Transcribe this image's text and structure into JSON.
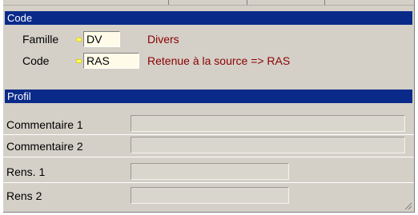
{
  "code_section": {
    "title": "Code",
    "famille": {
      "label": "Famille",
      "code": "DV",
      "description": "Divers"
    },
    "code": {
      "label": "Code",
      "code": "RAS",
      "description": "Retenue à la source => RAS"
    }
  },
  "profil_section": {
    "title": "Profil",
    "fields": [
      {
        "label": "Commentaire 1",
        "value": ""
      },
      {
        "label": "Commentaire 2",
        "value": ""
      },
      {
        "label": "Rens. 1",
        "value": ""
      },
      {
        "label": "Rens 2",
        "value": ""
      }
    ]
  },
  "colors": {
    "header_bg": "#0a2a8a",
    "description_text": "#8b0000",
    "required_marker": "#ffff66"
  },
  "icons": {
    "resize_grip": "resize-grip-icon",
    "required_marker": "required-marker-icon"
  }
}
